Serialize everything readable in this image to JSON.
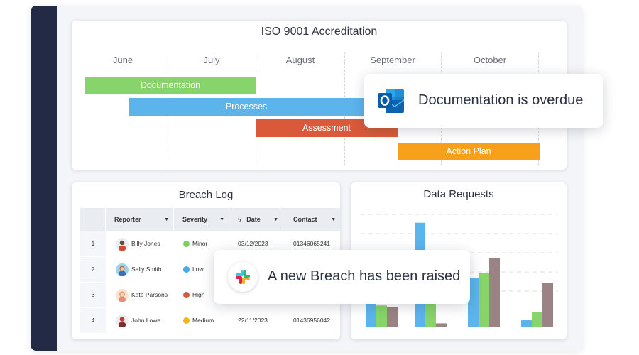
{
  "gantt": {
    "title": "ISO 9001 Accreditation",
    "months": [
      "June",
      "July",
      "August",
      "September",
      "October"
    ],
    "tasks": [
      {
        "label": "Documentation",
        "color": "#86d46b"
      },
      {
        "label": "Processes",
        "color": "#5cb4ec"
      },
      {
        "label": "Assessment",
        "color": "#d9593a"
      },
      {
        "label": "Action Plan",
        "color": "#f7a11b"
      }
    ]
  },
  "breach_log": {
    "title": "Breach Log",
    "columns": [
      "Reporter",
      "Severity",
      "Date",
      "Contact"
    ],
    "rows": [
      {
        "num": "1",
        "reporter": "Billy Jones",
        "severity": "Minor",
        "severity_color": "#7bd35a",
        "date": "03/12/2023",
        "contact": "01346065241"
      },
      {
        "num": "2",
        "reporter": "Sally Smith",
        "severity": "Low",
        "severity_color": "#4aa8e8",
        "date": "",
        "contact": ""
      },
      {
        "num": "3",
        "reporter": "Kate Parsons",
        "severity": "High",
        "severity_color": "#d9593a",
        "date": "",
        "contact": ""
      },
      {
        "num": "4",
        "reporter": "John Lowe",
        "severity": "Medium",
        "severity_color": "#f7b21b",
        "date": "22/11/2023",
        "contact": "01436956042"
      }
    ]
  },
  "data_requests": {
    "title": "Data Requests"
  },
  "notifications": {
    "outlook": {
      "message": "Documentation is overdue",
      "icon": "outlook-icon"
    },
    "slack": {
      "message": "A new Breach has been raised",
      "icon": "slack-icon"
    }
  },
  "colors": {
    "sidebar": "#222a45",
    "blue": "#5cb4ec",
    "green": "#86d46b",
    "mauve": "#9b8284"
  },
  "chart_data": {
    "type": "bar",
    "title": "Data Requests",
    "categories": [
      "",
      "",
      "",
      ""
    ],
    "series": [
      {
        "values": [
          38,
          64,
          30,
          4
        ]
      },
      {
        "values": [
          13,
          26,
          33,
          9
        ]
      },
      {
        "values": [
          12,
          2,
          42,
          27
        ]
      }
    ],
    "ylim": [
      0,
      70
    ],
    "grid": true
  }
}
